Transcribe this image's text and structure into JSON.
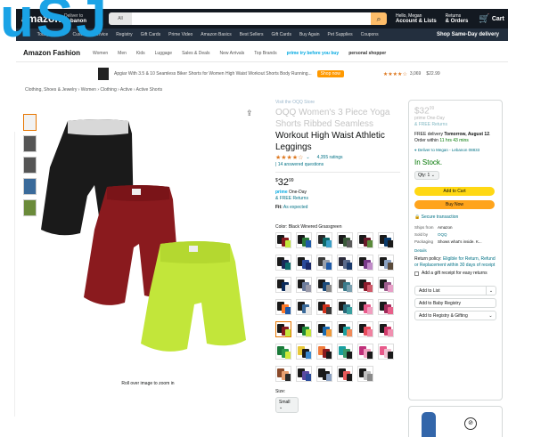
{
  "nav": {
    "logo": "amazon",
    "deliver_to": "Deliver to",
    "deliver_loc": "Lebanon",
    "search_category": "All",
    "hello": "Hello, Megan",
    "account": "Account & Lists",
    "returns": "Returns",
    "orders": "& Orders",
    "cart": "Cart"
  },
  "subnav": {
    "items": [
      "All",
      "Today's Deals",
      "Customer Service",
      "Registry",
      "Gift Cards",
      "Prime Video",
      "Amazon Basics",
      "Best Sellers",
      "Gift Cards",
      "Buy Again",
      "Pet Supplies",
      "Coupons"
    ],
    "highlight": "Shop Same-Day delivery"
  },
  "fashion": {
    "title": "Amazon Fashion",
    "items": [
      "Women",
      "Men",
      "Kids",
      "Luggage",
      "Sales & Deals",
      "New Arrivals",
      "Top Brands"
    ],
    "promo": "prime try before you buy",
    "promo2": "personal shopper"
  },
  "ad": {
    "text": "Apgiar With 3.5 & 10 Seamless Biker Shorts for Women High Waist Workout Shorts Body Running...",
    "shop": "Shop now",
    "stars": "★★★★☆",
    "reviews": "3,069",
    "price": "$22.99"
  },
  "breadcrumb": "Clothing, Shoes & Jewelry › Women › Clothing › Active › Active Shorts",
  "overlay_text": "uSJ",
  "caption": "Roll over image to zoom in",
  "product": {
    "visit": "Visit the OQQ Store",
    "title_faded": "OQQ Women's 3 Piece Yoga Shorts Ribbed Seamless",
    "title": "Workout High Waist Athletic Leggings",
    "stars": "★★★★☆",
    "rating_count": "4,355 ratings",
    "answered": "14 answered questions",
    "price_symbol": "$",
    "price_whole": "32",
    "price_frac": "99",
    "prime_label": "prime",
    "one_day": "One-Day",
    "free_returns": "& FREE Returns",
    "fit_label": "Fit:",
    "fit_value": "As expected",
    "color_label": "Color:",
    "color_value": "Black Winered Grassgreen",
    "size_label": "Size:",
    "size_value": "Small"
  },
  "buybox": {
    "price": "$32",
    "price_frac": "99",
    "prime_line": "prime One-Day",
    "free_returns": "& FREE Returns",
    "delivery_prefix": "FREE delivery",
    "delivery_date": "Tomorrow, August 12",
    "order_within": "Order within",
    "time": "11 hrs 43 mins",
    "location": "Deliver to Megan - Lebanon 08833",
    "stock": "In Stock.",
    "qty": "Qty: 1",
    "add_to_cart": "Add to Cart",
    "buy_now": "Buy Now",
    "secure": "Secure transaction",
    "ships_from_label": "Ships from",
    "ships_from": "Amazon",
    "sold_by_label": "Sold by",
    "sold_by": "OQQ",
    "packaging_label": "Packaging",
    "packaging": "Shows what's inside. K...",
    "details": "Details",
    "return_prefix": "Return policy:",
    "return_link": "Eligible for Return, Refund or Replacement within 30 days of receipt",
    "gift": "Add a gift receipt for easy returns",
    "add_to_list": "Add to List",
    "baby_registry": "Add to Baby Registry",
    "gifting": "Add to Registry & Gifting"
  },
  "colors": {
    "black": "#1a1a1a",
    "wine": "#8a1a1e",
    "lime": "#c2e63a",
    "amazon_dark": "#131921",
    "accent": "#ff9900",
    "overlay": "#1aa3e6"
  },
  "swatches": [
    [
      "#1a1a1a",
      "#8a1a1e",
      "#c2e63a"
    ],
    [
      "#1a1a1a",
      "#2a7a3a",
      "#1e5aa8"
    ],
    [
      "#2a2a2a",
      "#0e6b6b",
      "#3aa0c8"
    ],
    [
      "#1a1a1a",
      "#3a5a3a",
      "#5a5a5a"
    ],
    [
      "#1a1a1a",
      "#6a1a2a",
      "#5a8a3a"
    ],
    [
      "#1a1a1a",
      "#0a3a6a",
      "#1a1a1a"
    ],
    [
      "#1a1a1a",
      "#1a2a5a",
      "#0e6b6b"
    ],
    [
      "#1a1a1a",
      "#2a4a9a",
      "#1a2a6a"
    ],
    [
      "#3a3a3a",
      "#9aa0aa",
      "#1e5aa8"
    ],
    [
      "#2a2a3a",
      "#5a6a8a",
      "#1a3a6a"
    ],
    [
      "#1a1a1a",
      "#7a3a8a",
      "#c08ac8"
    ],
    [
      "#1a1a1a",
      "#8aa0c0",
      "#5a4a3a"
    ],
    [
      "#1a1a1a",
      "#0a2a5a",
      "#e8e8e8"
    ],
    [
      "#1a1a1a",
      "#6a7a9a",
      "#9a9aaa"
    ],
    [
      "#1a1a1a",
      "#1a4a7a",
      "#8a8a8a"
    ],
    [
      "#4a4a4a",
      "#3a7a8a",
      "#7aa0b0"
    ],
    [
      "#1a1a1a",
      "#8a1a2a",
      "#d05a6a"
    ],
    [
      "#1a1a1a",
      "#9a5a8a",
      "#e8a0c8"
    ],
    [
      "#1a1a1a",
      "#ff7a2a",
      "#1e5aa8"
    ],
    [
      "#1a1a1a",
      "#3a6a9a",
      "#e8e8e8"
    ],
    [
      "#1a1a1a",
      "#d0301a",
      "#3a3a3a"
    ],
    [
      "#1a1a1a",
      "#2a6a7a",
      "#3aa0a0"
    ],
    [
      "#1a1a1a",
      "#e85a8a",
      "#f0a0c0"
    ],
    [
      "#1a1a1a",
      "#a02a5a",
      "#e8608a"
    ],
    [
      "#1a1a1a",
      "#8a1a1e",
      "#c2e63a"
    ],
    [
      "#1a1a1a",
      "#1e8a3a",
      "#c2e63a"
    ],
    [
      "#1a1a1a",
      "#1a6ab0",
      "#f09a3a"
    ],
    [
      "#1a1a1a",
      "#1aa0a0",
      "#f08a5a"
    ],
    [
      "#1a1a1a",
      "#e84a5a",
      "#f080a0"
    ],
    [
      "#1a1a1a",
      "#d03a6a",
      "#f090b0"
    ],
    [
      "#1a7a3a",
      "#2a9a4a",
      "#d0e83a"
    ],
    [
      "#e8c83a",
      "#1a1a1a",
      "#3a8ad0"
    ],
    [
      "#f07a3a",
      "#8a1a1e",
      "#1a1a1a"
    ],
    [
      "#1aa0a0",
      "#3a9a6a",
      "#1a1a1a"
    ],
    [
      "#c0307a",
      "#f0a0c0",
      "#1a1a1a"
    ],
    [
      "#e85a8a",
      "#f0c0d0",
      "#1a1a1a"
    ],
    [
      "#8a4a2a",
      "#e8a070",
      "#2a2a2a"
    ],
    [
      "#1a1a1a",
      "#5a4aa0",
      "#2a4a9a"
    ],
    [
      "#1a1a1a",
      "#1a1a1a",
      "#8aa0c0"
    ],
    [
      "#1a1a1a",
      "#e85a5a",
      "#1a1a1a"
    ],
    [
      "#1a1a1a",
      "#c0c0c0",
      "#8a8a8a"
    ],
    []
  ]
}
